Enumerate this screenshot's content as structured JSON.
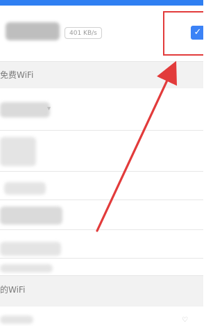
{
  "theme": {
    "top_bar_color": "#2f7ff2",
    "accent_blue": "#3b82f6",
    "annotation_red": "#e23b3b",
    "section_bg": "#f2f2f2",
    "divider": "#e6e6e6"
  },
  "connected_network": {
    "speed_badge": "401 KB/s",
    "checked": true,
    "check_icon": "check-icon"
  },
  "sections": {
    "free_wifi": "免费WiFi",
    "my_wifi": "的WiFi"
  },
  "wifi_lists": {
    "free_wifi_item_count": 6,
    "my_wifi_item_count": 1
  },
  "annotations": {
    "highlight_box_color": "#e23b3b",
    "arrow_color": "#e23b3b"
  }
}
